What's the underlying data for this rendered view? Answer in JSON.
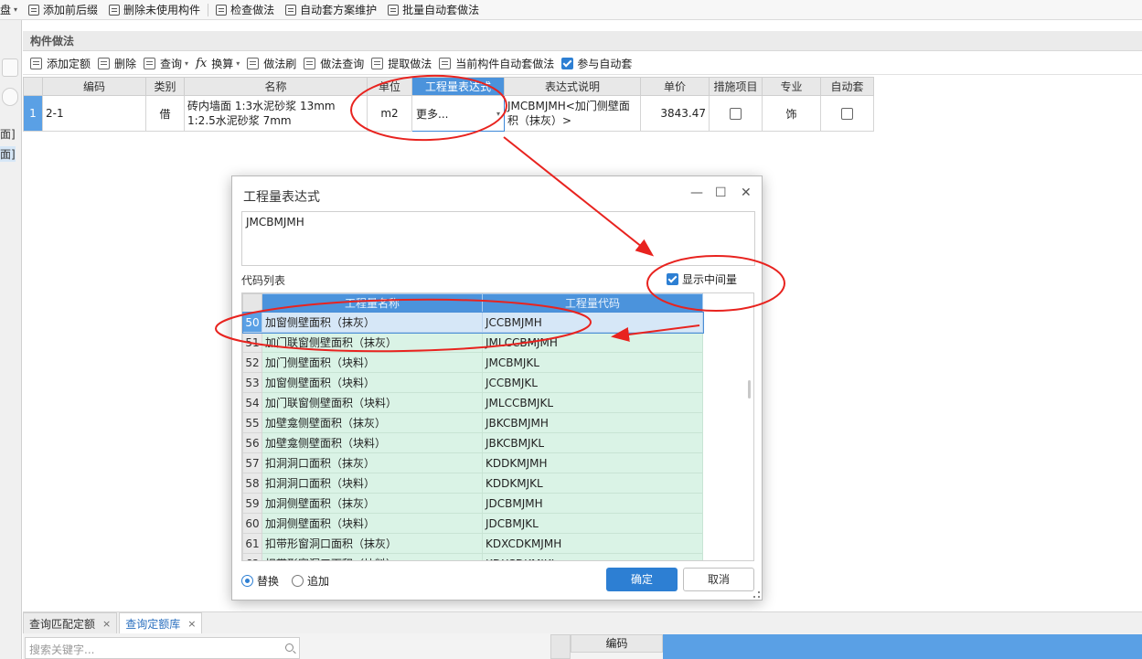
{
  "top_toolbar": {
    "items": [
      {
        "label": "存盘",
        "caret": "▾"
      },
      {
        "label": "添加前后缀"
      },
      {
        "label": "删除未使用构件"
      },
      {
        "label": "检查做法"
      },
      {
        "label": "自动套方案维护"
      },
      {
        "label": "批量自动套做法"
      }
    ]
  },
  "left_strip": {
    "labels": [
      "面]",
      "面]"
    ]
  },
  "panel": {
    "title": "构件做法",
    "toolbar": [
      {
        "label": "添加定额"
      },
      {
        "label": "删除"
      },
      {
        "label": "查询",
        "caret": "▾"
      },
      {
        "label": "换算",
        "caret": "▾",
        "icon": "fx"
      },
      {
        "label": "做法刷"
      },
      {
        "label": "做法查询"
      },
      {
        "label": "提取做法"
      },
      {
        "label": "当前构件自动套做法"
      },
      {
        "label": "参与自动套",
        "checked": true
      }
    ]
  },
  "main_table": {
    "headers": [
      "编码",
      "类别",
      "名称",
      "单位",
      "工程量表达式",
      "表达式说明",
      "单价",
      "措施项目",
      "专业",
      "自动套"
    ],
    "row": {
      "num": "1",
      "code": "2-1",
      "category": "借",
      "name": "砖内墙面 1:3水泥砂浆 13mm 1:2.5水泥砂浆 7mm",
      "unit": "m2",
      "expression": "更多...",
      "expression_desc": "JMCBMJMH<加门侧壁面积（抹灰）>",
      "price": "3843.47",
      "measure_item": false,
      "specialty": "饰",
      "auto_apply": false
    }
  },
  "dialog": {
    "title": "工程量表达式",
    "controls": {
      "minimize": "—",
      "maximize": "☐",
      "close": "✕"
    },
    "expression": "JMCBMJMH",
    "code_list_label": "代码列表",
    "show_intermediate_label": "显示中间量",
    "show_intermediate_checked": true,
    "grid_headers": [
      "工程量名称",
      "工程量代码"
    ],
    "rows": [
      {
        "num": "50",
        "name": "加窗侧壁面积（抹灰）",
        "code": "JCCBMJMH",
        "selected": true
      },
      {
        "num": "51",
        "name": "加门联窗侧壁面积（抹灰）",
        "code": "JMLCCBMJMH"
      },
      {
        "num": "52",
        "name": "加门侧壁面积（块料）",
        "code": "JMCBMJKL"
      },
      {
        "num": "53",
        "name": "加窗侧壁面积（块料）",
        "code": "JCCBMJKL"
      },
      {
        "num": "54",
        "name": "加门联窗侧壁面积（块料）",
        "code": "JMLCCBMJKL"
      },
      {
        "num": "55",
        "name": "加壁龛侧壁面积（抹灰）",
        "code": "JBKCBMJMH"
      },
      {
        "num": "56",
        "name": "加壁龛侧壁面积（块料）",
        "code": "JBKCBMJKL"
      },
      {
        "num": "57",
        "name": "扣洞洞口面积（抹灰）",
        "code": "KDDKMJMH"
      },
      {
        "num": "58",
        "name": "扣洞洞口面积（块料）",
        "code": "KDDKMJKL"
      },
      {
        "num": "59",
        "name": "加洞侧壁面积（抹灰）",
        "code": "JDCBMJMH"
      },
      {
        "num": "60",
        "name": "加洞侧壁面积（块料）",
        "code": "JDCBMJKL"
      },
      {
        "num": "61",
        "name": "扣带形窗洞口面积（抹灰）",
        "code": "KDXCDKMJMH"
      },
      {
        "num": "62",
        "name": "扣带形窗洞口面积（块料）",
        "code": "KDXCDKMJKL"
      }
    ],
    "radio_replace": "替换",
    "radio_append": "追加",
    "radio_selected": "替换",
    "ok_label": "确定",
    "cancel_label": "取消"
  },
  "bottom": {
    "tabs": [
      {
        "label": "查询匹配定额",
        "close": "×"
      },
      {
        "label": "查询定额库",
        "close": "×",
        "active": true
      }
    ],
    "search_placeholder": "搜索关键字...",
    "library_header": "编码"
  },
  "colors": {
    "accent_blue": "#2d7fd3",
    "header_blue": "#4b93dc",
    "row_green": "#daf3e6",
    "annotation_red": "#e8231f"
  }
}
